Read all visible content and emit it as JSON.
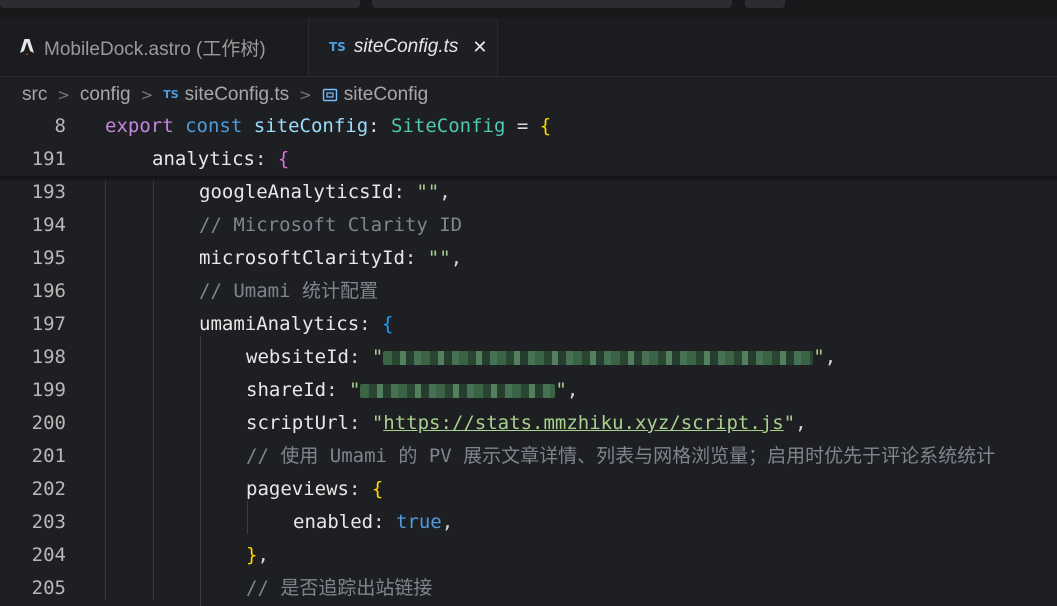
{
  "tabs": [
    {
      "label": "MobileDock.astro (工作树)",
      "icon": "astro-icon",
      "active": false
    },
    {
      "label": "siteConfig.ts",
      "icon": "ts-icon",
      "icon_text": "TS",
      "active": true
    }
  ],
  "breadcrumb": [
    "src",
    "config",
    "siteConfig.ts",
    "siteConfig"
  ],
  "breadcrumb_ts_icon": "TS",
  "lines": {
    "l8": {
      "num": "8",
      "export": "export",
      "const": "const",
      "name": "siteConfig",
      "colon": ":",
      "type": "SiteConfig",
      "eq": " = ",
      "brace": "{"
    },
    "l191": {
      "num": "191",
      "prop": "analytics",
      "colon": ": ",
      "brace": "{"
    },
    "l193": {
      "num": "193",
      "prop": "googleAnalyticsId",
      "colon": ": ",
      "val": "\"\"",
      "end": ","
    },
    "l194": {
      "num": "194",
      "comment": "// Microsoft Clarity ID"
    },
    "l195": {
      "num": "195",
      "prop": "microsoftClarityId",
      "colon": ": ",
      "val": "\"\"",
      "end": ","
    },
    "l196": {
      "num": "196",
      "comment": "// Umami 统计配置"
    },
    "l197": {
      "num": "197",
      "prop": "umamiAnalytics",
      "colon": ": ",
      "brace": "{"
    },
    "l198": {
      "num": "198",
      "prop": "websiteId",
      "colon": ": ",
      "q1": "\"",
      "q2": "\"",
      "end": ","
    },
    "l199": {
      "num": "199",
      "prop": "shareId",
      "colon": ": ",
      "q1": "\"",
      "q2": "\"",
      "end": ","
    },
    "l200": {
      "num": "200",
      "prop": "scriptUrl",
      "colon": ": ",
      "q1": "\"",
      "url": "https://stats.mmzhiku.xyz/script.js",
      "q2": "\"",
      "end": ","
    },
    "l201": {
      "num": "201",
      "comment": "// 使用 Umami 的 PV 展示文章详情、列表与网格浏览量；启用时优先于评论系统统计"
    },
    "l202": {
      "num": "202",
      "prop": "pageviews",
      "colon": ": ",
      "brace": "{"
    },
    "l203": {
      "num": "203",
      "prop": "enabled",
      "colon": ": ",
      "val": "true",
      "end": ","
    },
    "l204": {
      "num": "204",
      "brace": "}",
      "end": ","
    },
    "l205": {
      "num": "205",
      "comment": "// 是否追踪出站链接"
    }
  },
  "colors": {
    "background": "#1e1f22",
    "keyword": "#c586e0",
    "type": "#4ec9b0",
    "comment": "#7f848e",
    "string": "#a8d08d"
  }
}
